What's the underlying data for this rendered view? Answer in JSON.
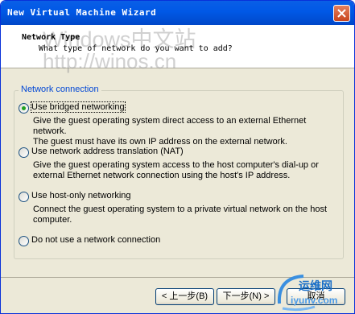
{
  "window": {
    "title": "New Virtual Machine Wizard"
  },
  "header": {
    "title": "Network Type",
    "subtitle": "What type of network do you want to add?"
  },
  "watermark": {
    "line1": "Windows中文站",
    "line2": "http://winos.cn"
  },
  "group": {
    "label": "Network connection"
  },
  "options": [
    {
      "label": "Use bridged networking",
      "selected": true,
      "desc": [
        "Give the guest operating system direct access to an external Ethernet network.",
        "The guest must have its own IP address on the external network."
      ]
    },
    {
      "label": "Use network address translation (NAT)",
      "selected": false,
      "desc": [
        "Give the guest operating system access to the host computer's dial-up or",
        "external Ethernet network connection using the host's IP address."
      ]
    },
    {
      "label": "Use host-only networking",
      "selected": false,
      "desc": [
        "Connect the guest operating system to a private virtual network on the host",
        "computer."
      ]
    },
    {
      "label": "Do not use a network connection",
      "selected": false,
      "desc": []
    }
  ],
  "buttons": {
    "back": "< 上一步(B)",
    "next": "下一步(N) >",
    "cancel": "取消"
  },
  "logo": {
    "cn": "运维网",
    "url": "iyunv.com"
  }
}
